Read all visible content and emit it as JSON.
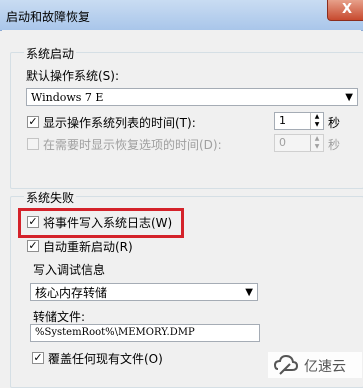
{
  "window": {
    "title": "启动和故障恢复",
    "close": "X"
  },
  "startup": {
    "group_label": "系统启动",
    "default_os_label": "默认操作系统(S):",
    "default_os_value": "Windows 7 E",
    "show_list_label": "显示操作系统列表的时间(T):",
    "show_list_checked": true,
    "show_list_value": "1",
    "show_list_unit": "秒",
    "show_recovery_label": "在需要时显示恢复选项的时间(D):",
    "show_recovery_checked": false,
    "show_recovery_value": "0",
    "show_recovery_unit": "秒"
  },
  "failure": {
    "group_label": "系统失败",
    "write_log_label": "将事件写入系统日志(W)",
    "write_log_checked": true,
    "auto_restart_label": "自动重新启动(R)",
    "auto_restart_checked": true,
    "debug_group_label": "写入调试信息",
    "debug_type_value": "核心内存转储",
    "dump_file_label": "转储文件:",
    "dump_file_value": "%SystemRoot%\\MEMORY.DMP",
    "overwrite_label": "覆盖任何现有文件(O)",
    "overwrite_checked": true
  },
  "watermark": {
    "text": "亿速云",
    "logo_icon": "cloud-logo-icon"
  },
  "colors": {
    "highlight": "#d4222a",
    "titlebar": "#b8d1ef"
  }
}
